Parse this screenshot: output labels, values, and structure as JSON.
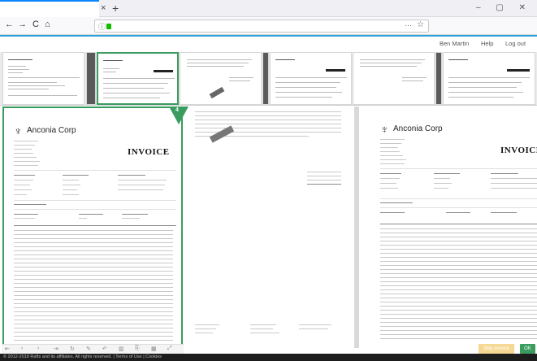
{
  "browser": {
    "tab_close": "×",
    "tab_new": "+",
    "window_controls": "– ▢ ✕",
    "nav_back": "←",
    "nav_forward": "→",
    "nav_reload": "C",
    "nav_home": "⌂",
    "url_info": "ⓘ",
    "url_more": "···",
    "url_star": "☆"
  },
  "header": {
    "user": "Ben Martin",
    "help": "Help",
    "logout": "Log out"
  },
  "invoice": {
    "company": "Anconia Corp",
    "title": "INVOICE",
    "page_number": "4"
  },
  "footer": {
    "copyright": "© 2012-2018 Rafts and its affiliates. All rights reserved. | Terms of Use | Cookies"
  },
  "actions": {
    "skip_label": "Skip invoice",
    "ok_label": "OK"
  },
  "colors": {
    "accent": "#2ea3d8",
    "selected": "#3a9c5f",
    "skip": "#f5d893"
  }
}
